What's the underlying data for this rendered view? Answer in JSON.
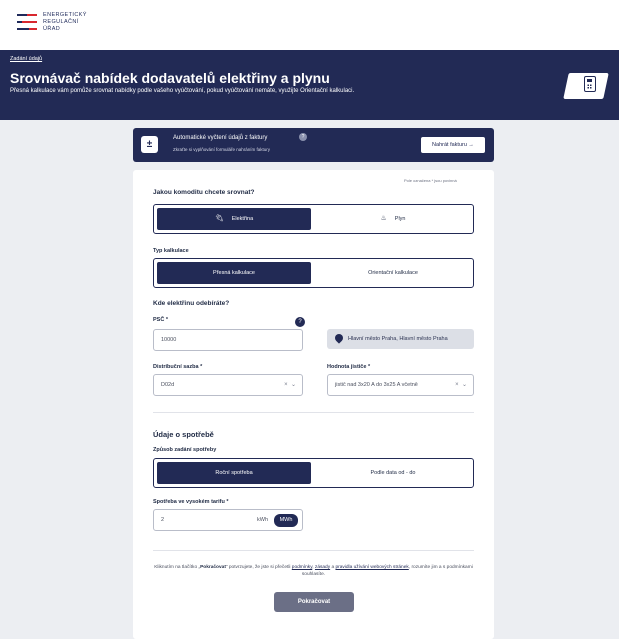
{
  "logo": {
    "line1": "ENERGETICKÝ",
    "line2": "REGULAČNÍ",
    "line3": "ÚŘAD"
  },
  "hero": {
    "breadcrumb": "Zadání údajů",
    "title": "Srovnávač nabídek dodavatelů elektřiny a plynu",
    "subtitle": "Přesná kalkulace vám pomůže srovnat nabídky podle vašeho vyúčtování, pokud vyúčtování nemáte, využijte Orientační kalkulaci."
  },
  "upload": {
    "title": "Automatické vyčtení údajů z faktury",
    "subtitle": "Zkraťte si vyplňování formuláře nahráním faktury",
    "button": "Nahrát fakturu →"
  },
  "form": {
    "required_note": "Pole označena * jsou povinná",
    "commodity": {
      "label": "Jakou komoditu chcete srovnat?",
      "options": [
        "Elektřina",
        "Plyn"
      ],
      "selected": "Elektřina"
    },
    "calc_type": {
      "label": "Typ kalkulace",
      "options": [
        "Přesná kalkulace",
        "Orientační kalkulace"
      ],
      "selected": "Přesná kalkulace"
    },
    "location_heading": "Kde elektřinu odebíráte?",
    "psc": {
      "label": "PSČ *",
      "value": "10000"
    },
    "location_result": "Hlavní město Praha, Hlavní město Praha",
    "tariff": {
      "label": "Distribuční sazba *",
      "value": "D02d"
    },
    "breaker": {
      "label": "Hodnota jističe *",
      "value": "jistič nad 3x20 A do 3x25 A včetně"
    },
    "consumption_heading": "Údaje o spotřebě",
    "consumption_mode": {
      "label": "Způsob zadání spotřeby",
      "options": [
        "Roční spotřeba",
        "Podle data od - do"
      ],
      "selected": "Roční spotřeba"
    },
    "high_tariff": {
      "label": "Spotřeba ve vysokém tarifu *",
      "value": "2",
      "unit_off": "kWh",
      "unit_on": "MWh"
    },
    "consent": {
      "p1": "Kliknutím na tlačítko „",
      "button_ref": "Pokračovat",
      "p2": "“ potvrzujete, že jste si přečetli ",
      "link1": "podmínky",
      "sep1": ", ",
      "link2": "zásady",
      "p3": " a ",
      "link3": "pravidla užívání webových stránek",
      "p4": ", rozumíte jim a s podmínkami souhlasíte."
    },
    "continue_button": "Pokračovat"
  },
  "colors": {
    "primary": "#222a55",
    "accent_red": "#d8282f",
    "page_bg": "#eceef2",
    "button_disabled": "#6b6f86"
  }
}
